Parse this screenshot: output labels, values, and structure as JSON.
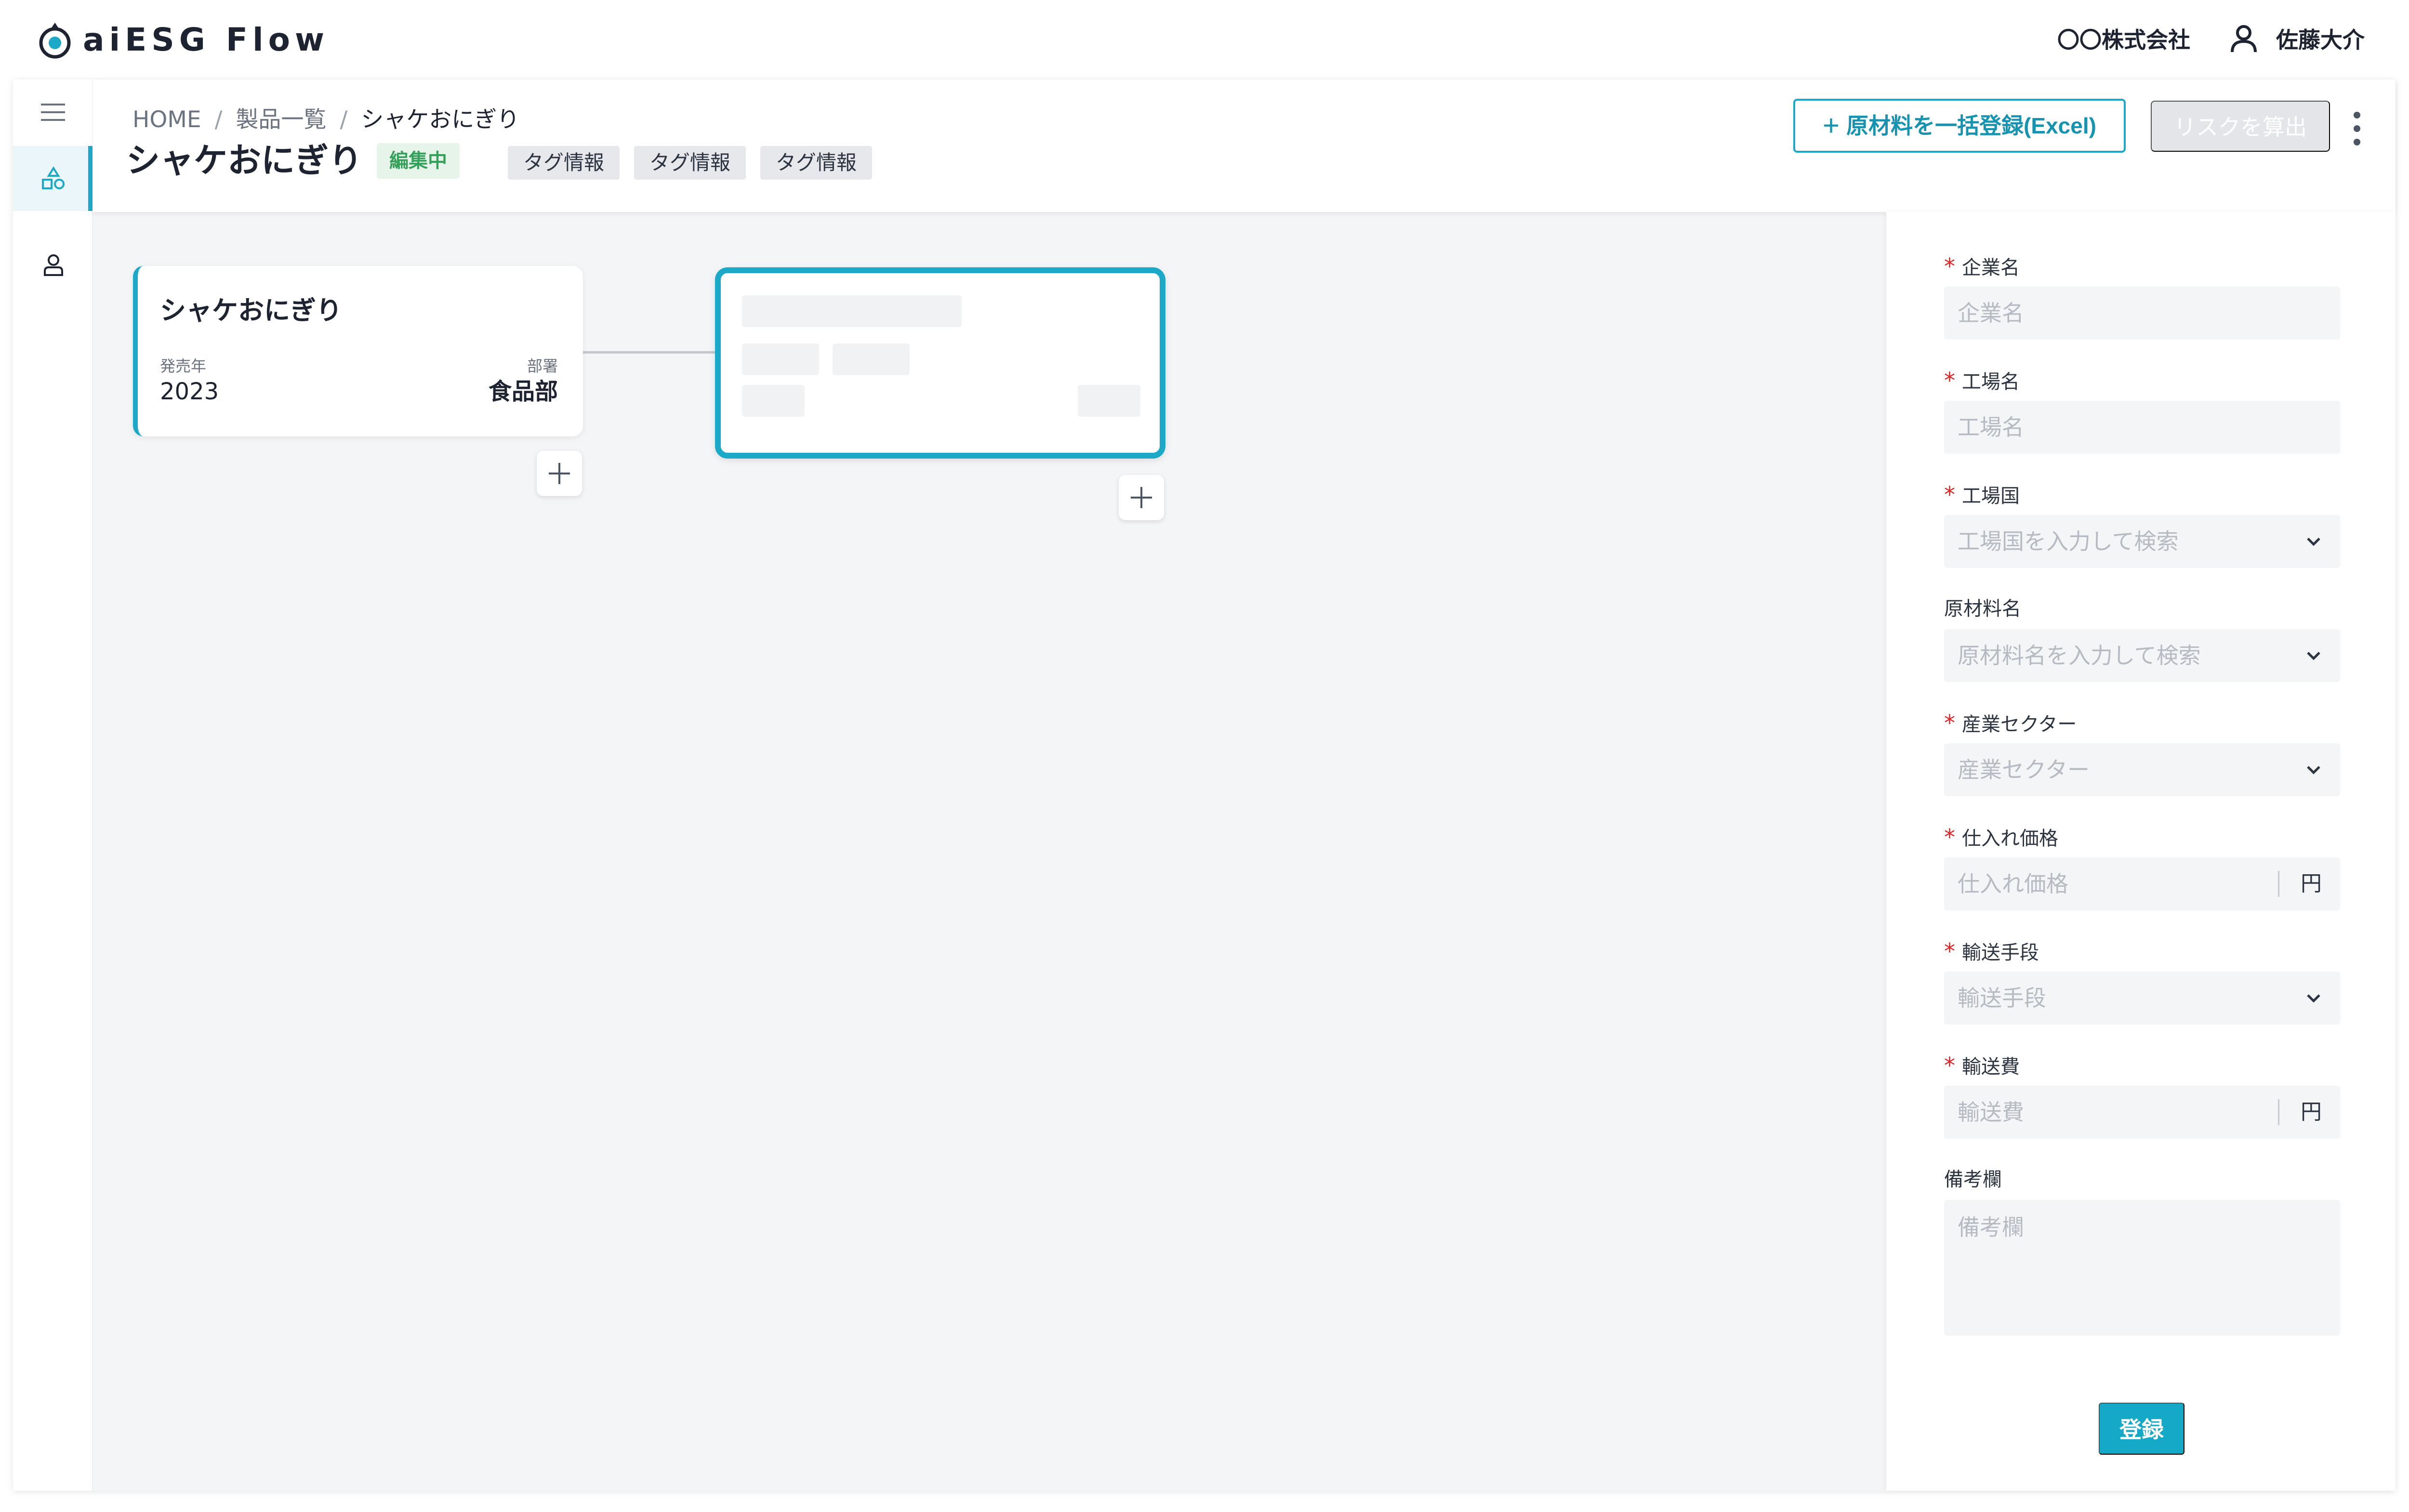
{
  "app": {
    "brand": "aiESG Flow",
    "company": "〇〇株式会社",
    "user_name": "佐藤大介"
  },
  "colors": {
    "accent": "#1BA9C7",
    "canvas_bg": "#F4F5F7",
    "status_green": "#34A05A",
    "required_red": "#E02424"
  },
  "icons": {
    "rail": [
      "menu-icon",
      "products-icon",
      "user-icon"
    ],
    "header": [
      "user-icon",
      "kebab-icon"
    ]
  },
  "breadcrumb": {
    "home": "HOME",
    "separator": "/",
    "products": "製品一覧",
    "current": "シャケおにぎり"
  },
  "page": {
    "title": "シャケおにぎり",
    "status": "編集中",
    "tags": [
      "タグ情報",
      "タグ情報",
      "タグ情報"
    ],
    "bulk_register_label": "原材料を一括登録(Excel)",
    "calc_risk_label": "リスクを算出"
  },
  "product_card": {
    "name": "シャケおにぎり",
    "release_year_label": "発売年",
    "release_year": "2023",
    "department_label": "部署",
    "department": "食品部"
  },
  "form": {
    "fields": [
      {
        "label": "企業名",
        "required": "*",
        "placeholder": "企業名",
        "kind": "text"
      },
      {
        "label": "工場名",
        "required": "*",
        "placeholder": "工場名",
        "kind": "text"
      },
      {
        "label": "工場国",
        "required": "*",
        "placeholder": "工場国を入力して検索",
        "kind": "select"
      },
      {
        "label": "原材料名",
        "required": "",
        "placeholder": "原材料名を入力して検索",
        "kind": "select"
      },
      {
        "label": "産業セクター",
        "required": "*",
        "placeholder": "産業セクター",
        "kind": "select"
      },
      {
        "label": "仕入れ価格",
        "required": "*",
        "placeholder": "仕入れ価格",
        "kind": "unit",
        "unit": "円"
      },
      {
        "label": "輸送手段",
        "required": "*",
        "placeholder": "輸送手段",
        "kind": "select"
      },
      {
        "label": "輸送費",
        "required": "*",
        "placeholder": "輸送費",
        "kind": "unit",
        "unit": "円"
      },
      {
        "label": "備考欄",
        "required": "",
        "placeholder": "備考欄",
        "kind": "textarea"
      }
    ],
    "submit_label": "登録"
  }
}
